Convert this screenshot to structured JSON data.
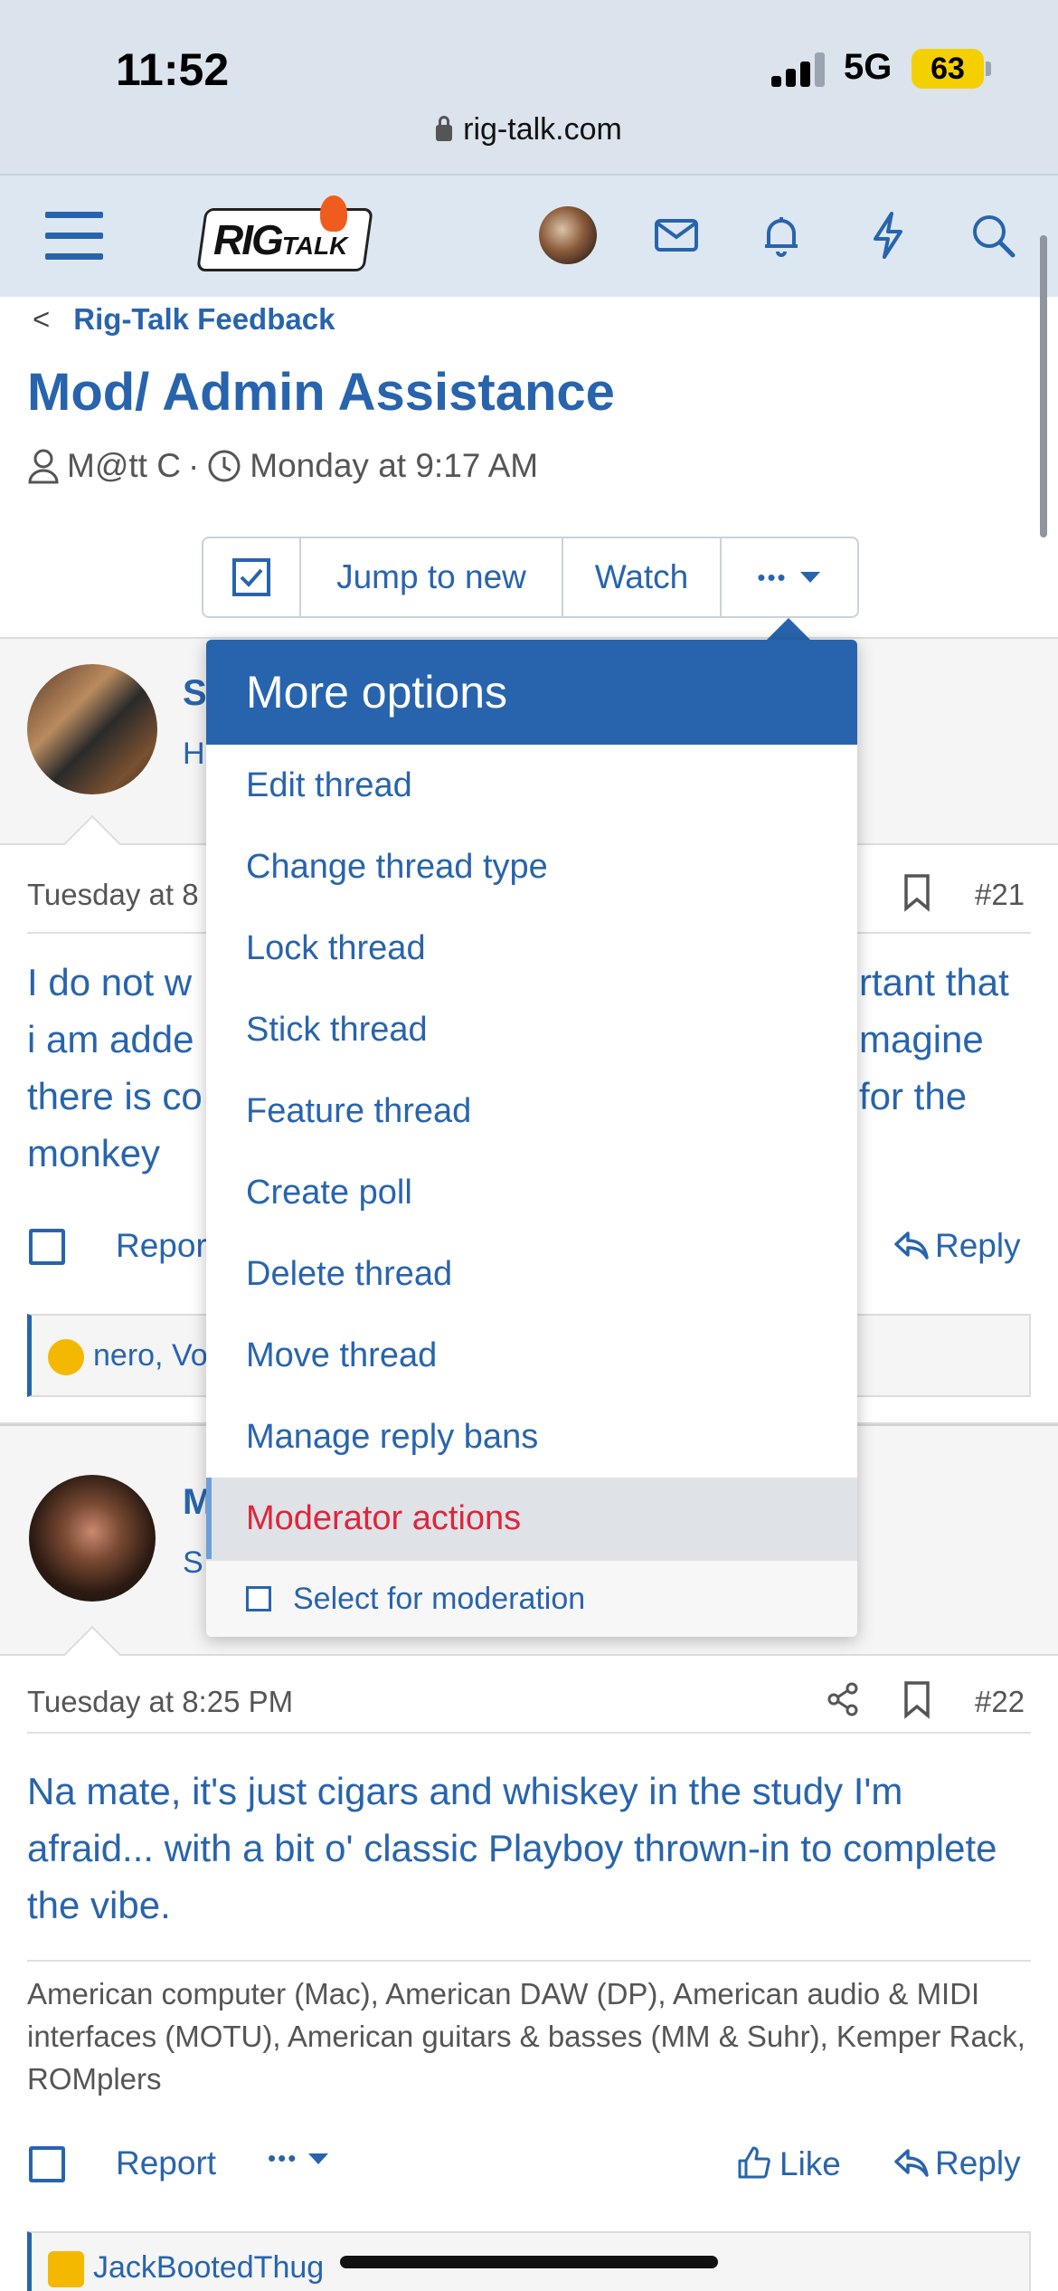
{
  "status_bar": {
    "time": "11:52",
    "network": "5G",
    "battery": "63"
  },
  "browser": {
    "url": "rig-talk.com"
  },
  "header": {
    "logo_text": "RIG",
    "logo_sub": "TALK"
  },
  "breadcrumb": {
    "label": "Rig-Talk Feedback"
  },
  "thread": {
    "title": "Mod/ Admin Assistance",
    "author": "M@tt C",
    "separator": "·",
    "date": "Monday at 9:17 AM"
  },
  "thread_actions": {
    "jump_to_new": "Jump to new",
    "watch": "Watch",
    "more": "•••"
  },
  "menu": {
    "title": "More options",
    "items": [
      "Edit thread",
      "Change thread type",
      "Lock thread",
      "Stick thread",
      "Feature thread",
      "Create poll",
      "Delete thread",
      "Move thread",
      "Manage reply bans",
      "Moderator actions"
    ],
    "select_for_moderation": "Select for moderation"
  },
  "post1": {
    "name_partial": "S",
    "sub_partial": "H",
    "date_partial": "Tuesday at 8",
    "number": "#21",
    "body_left": [
      "I do not w",
      "i am adde",
      "there is co",
      "monkey"
    ],
    "body_right": [
      "rtant that",
      "magine",
      "for the",
      ""
    ],
    "report_partial": "Repor",
    "reply": "Reply",
    "reactions_partial": "nero, Vo"
  },
  "post2": {
    "name_partial": "M",
    "sub_partial": "S",
    "date": "Tuesday at 8:25 PM",
    "number": "#22",
    "body": "Na mate, it's just cigars and whiskey in the study I'm afraid... with a bit o' classic Playboy thrown-in to complete the vibe.",
    "signature": "American computer (Mac), American DAW (DP), American audio & MIDI interfaces (MOTU), American guitars & basses (MM & Suhr), Kemper Rack, ROMplers",
    "report": "Report",
    "more": "•••",
    "like": "Like",
    "reply": "Reply",
    "reactions_partial": "JackBootedThug"
  },
  "colors": {
    "accent": "#2864ad",
    "moderator_red": "#e0253a",
    "battery": "#f5d000"
  }
}
